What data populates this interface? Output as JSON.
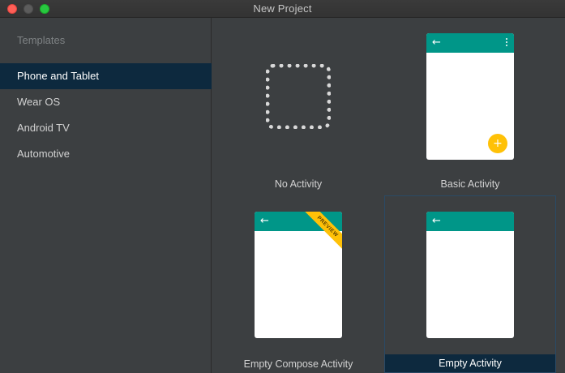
{
  "window": {
    "title": "New Project"
  },
  "sidebar": {
    "header": "Templates",
    "items": [
      {
        "label": "Phone and Tablet",
        "selected": true
      },
      {
        "label": "Wear OS",
        "selected": false
      },
      {
        "label": "Android TV",
        "selected": false
      },
      {
        "label": "Automotive",
        "selected": false
      }
    ]
  },
  "templates": [
    {
      "label": "No Activity",
      "selected": false
    },
    {
      "label": "Basic Activity",
      "selected": false
    },
    {
      "label": "Empty Compose Activity",
      "selected": false,
      "badge": "PREVIEW"
    },
    {
      "label": "Empty Activity",
      "selected": true
    }
  ],
  "colors": {
    "app_bar": "#009688",
    "fab": "#ffc107",
    "selection": "#0d293e"
  },
  "icons": {
    "back": "arrow-left-icon",
    "overflow": "kebab-menu-icon",
    "fab": "plus-icon"
  }
}
